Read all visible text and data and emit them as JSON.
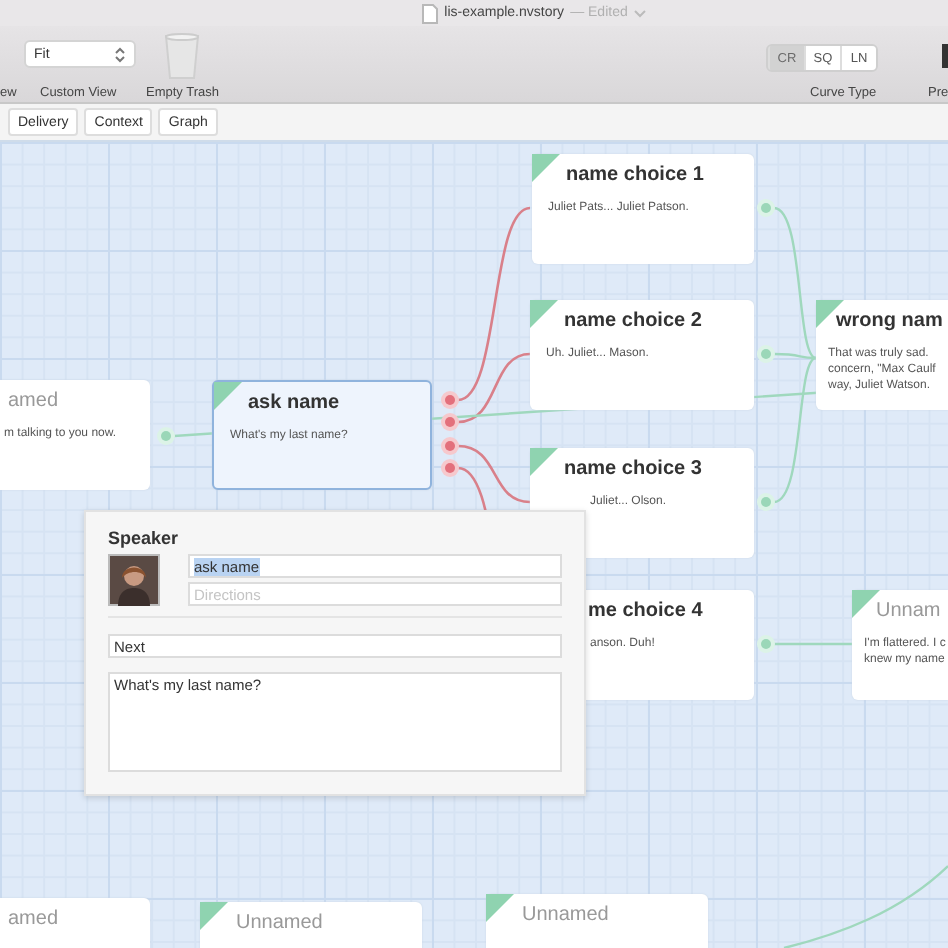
{
  "window": {
    "title": "lis-example.nvstory",
    "status": "— Edited"
  },
  "toolbar": {
    "zoom_select": "Fit",
    "labels": [
      "ew",
      "Custom View",
      "Empty Trash"
    ],
    "curve_type": {
      "label": "Curve Type",
      "options": [
        {
          "label": "CR",
          "selected": true
        },
        {
          "label": "SQ",
          "selected": false
        },
        {
          "label": "LN",
          "selected": false
        }
      ]
    },
    "cut_label": "Pre"
  },
  "tabs": [
    {
      "label": "Delivery"
    },
    {
      "label": "Context"
    },
    {
      "label": "Graph"
    }
  ],
  "nodes": [
    {
      "title": "amed",
      "body": [
        "m talking to you now."
      ],
      "named": false,
      "selected": false
    },
    {
      "title": "ask name",
      "body": [
        "What's my last name?"
      ],
      "named": true,
      "selected": true
    },
    {
      "title": "name choice 1",
      "body": [
        "Juliet Pats... Juliet Patson."
      ],
      "named": true,
      "selected": false
    },
    {
      "title": "name choice 2",
      "body": [
        "Uh. Juliet... Mason."
      ],
      "named": true,
      "selected": false
    },
    {
      "title": "name choice 3",
      "body": [
        "Juliet... Olson."
      ],
      "named": true,
      "selected": false
    },
    {
      "title": "me choice 4",
      "body": [
        "anson. Duh!"
      ],
      "named": true,
      "selected": false
    },
    {
      "title": "wrong nam",
      "body": [
        "That was truly sad.",
        "concern, \"Max Caulf",
        "way, Juliet Watson."
      ],
      "named": true,
      "selected": false
    },
    {
      "title": "Unnam",
      "body": [
        "I'm flattered. I c",
        "knew my name"
      ],
      "named": false,
      "selected": false
    },
    {
      "title": "amed",
      "named": false,
      "selected": false
    },
    {
      "title": "Unnamed",
      "named": false,
      "selected": false
    },
    {
      "title": "Unnamed",
      "named": false,
      "selected": false
    }
  ],
  "popover": {
    "heading": "Speaker",
    "name_value": "ask name",
    "directions_placeholder": "Directions",
    "next_value": "Next",
    "dialogue_value": "What's my last name?"
  }
}
